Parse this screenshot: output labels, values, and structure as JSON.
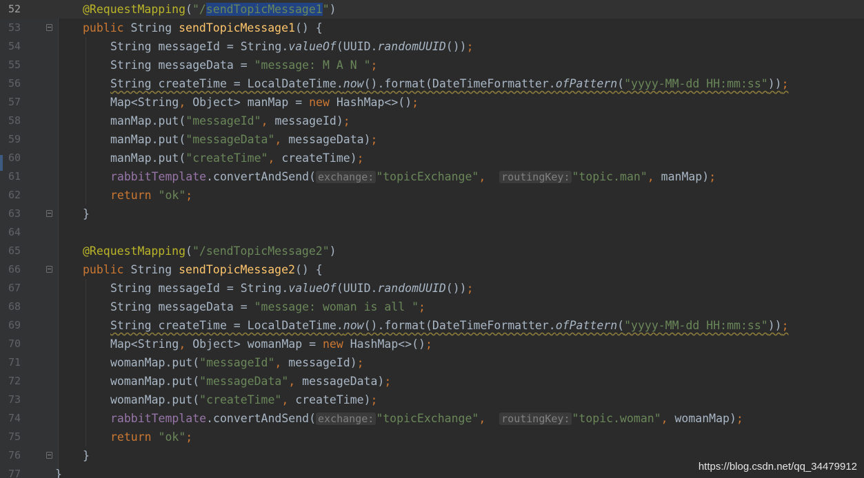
{
  "editor": {
    "current_line": 52,
    "watermark": "https://blog.csdn.net/qq_34479912",
    "closing_brace": "}",
    "colors": {
      "background": "#2b2b2b",
      "keyword": "#cc7832",
      "annotation": "#bbb529",
      "string": "#6a8759",
      "field": "#9876aa",
      "method_decl": "#ffc66d",
      "default_text": "#a9b7c6",
      "selection": "#214283"
    },
    "icons": [
      "fold-collapse-icon",
      "fold-end-icon"
    ]
  },
  "lines": [
    {
      "num": "52",
      "indent": 1,
      "fold": false,
      "tokens": [
        {
          "t": "@RequestMapping",
          "c": "ann"
        },
        {
          "t": "(",
          "c": ""
        },
        {
          "t": "\"/",
          "c": "str"
        },
        {
          "t": "sendTopicMessage1",
          "c": "str sel"
        },
        {
          "t": "\"",
          "c": "str"
        },
        {
          "t": ")",
          "c": ""
        }
      ]
    },
    {
      "num": "53",
      "indent": 1,
      "fold": true,
      "tokens": [
        {
          "t": "public ",
          "c": "kw"
        },
        {
          "t": "String ",
          "c": ""
        },
        {
          "t": "sendTopicMessage1",
          "c": "fn"
        },
        {
          "t": "() {",
          "c": ""
        }
      ]
    },
    {
      "num": "54",
      "indent": 2,
      "fold": false,
      "tokens": [
        {
          "t": "String messageId = String.",
          "c": ""
        },
        {
          "t": "valueOf",
          "c": "ital"
        },
        {
          "t": "(UUID.",
          "c": ""
        },
        {
          "t": "randomUUID",
          "c": "ital"
        },
        {
          "t": "())",
          "c": ""
        },
        {
          "t": ";",
          "c": "kw"
        }
      ]
    },
    {
      "num": "55",
      "indent": 2,
      "fold": false,
      "tokens": [
        {
          "t": "String messageData = ",
          "c": ""
        },
        {
          "t": "\"message: M A N \"",
          "c": "str"
        },
        {
          "t": ";",
          "c": "kw"
        }
      ]
    },
    {
      "num": "56",
      "indent": 2,
      "fold": false,
      "tokens": [
        {
          "t": "String createTime = LocalDateTime.",
          "c": "warn"
        },
        {
          "t": "now",
          "c": "ital warn"
        },
        {
          "t": "().format(DateTimeFormatter.",
          "c": "warn"
        },
        {
          "t": "ofPattern",
          "c": "ital warn"
        },
        {
          "t": "(",
          "c": "warn"
        },
        {
          "t": "\"yyyy-MM-dd HH:mm:ss\"",
          "c": "str warn"
        },
        {
          "t": "))",
          "c": "warn"
        },
        {
          "t": ";",
          "c": "kw warn"
        }
      ]
    },
    {
      "num": "57",
      "indent": 2,
      "fold": false,
      "tokens": [
        {
          "t": "Map<String",
          "c": ""
        },
        {
          "t": ", ",
          "c": "kw"
        },
        {
          "t": "Object> manMap = ",
          "c": ""
        },
        {
          "t": "new ",
          "c": "kw"
        },
        {
          "t": "HashMap<>()",
          "c": ""
        },
        {
          "t": ";",
          "c": "kw"
        }
      ]
    },
    {
      "num": "58",
      "indent": 2,
      "fold": false,
      "tokens": [
        {
          "t": "manMap.put(",
          "c": ""
        },
        {
          "t": "\"messageId\"",
          "c": "str"
        },
        {
          "t": ", ",
          "c": "kw"
        },
        {
          "t": "messageId)",
          "c": ""
        },
        {
          "t": ";",
          "c": "kw"
        }
      ]
    },
    {
      "num": "59",
      "indent": 2,
      "fold": false,
      "tokens": [
        {
          "t": "manMap.put(",
          "c": ""
        },
        {
          "t": "\"messageData\"",
          "c": "str"
        },
        {
          "t": ", ",
          "c": "kw"
        },
        {
          "t": "messageData)",
          "c": ""
        },
        {
          "t": ";",
          "c": "kw"
        }
      ]
    },
    {
      "num": "60",
      "indent": 2,
      "fold": false,
      "tokens": [
        {
          "t": "manMap.put(",
          "c": ""
        },
        {
          "t": "\"createTime\"",
          "c": "str"
        },
        {
          "t": ", ",
          "c": "kw"
        },
        {
          "t": "createTime)",
          "c": ""
        },
        {
          "t": ";",
          "c": "kw"
        }
      ]
    },
    {
      "num": "61",
      "indent": 2,
      "fold": false,
      "tokens": [
        {
          "t": "rabbitTemplate",
          "c": "fld"
        },
        {
          "t": ".convertAndSend(",
          "c": ""
        },
        {
          "t": "exchange:",
          "c": "hint"
        },
        {
          "t": "\"topicExchange\"",
          "c": "str"
        },
        {
          "t": ",  ",
          "c": "kw"
        },
        {
          "t": "routingKey:",
          "c": "hint"
        },
        {
          "t": "\"topic.man\"",
          "c": "str"
        },
        {
          "t": ", ",
          "c": "kw"
        },
        {
          "t": "manMap)",
          "c": ""
        },
        {
          "t": ";",
          "c": "kw"
        }
      ]
    },
    {
      "num": "62",
      "indent": 2,
      "fold": false,
      "tokens": [
        {
          "t": "return ",
          "c": "kw"
        },
        {
          "t": "\"ok\"",
          "c": "str"
        },
        {
          "t": ";",
          "c": "kw"
        }
      ]
    },
    {
      "num": "63",
      "indent": 1,
      "fold": true,
      "tokens": [
        {
          "t": "}",
          "c": ""
        }
      ]
    },
    {
      "num": "64",
      "indent": 0,
      "fold": false,
      "tokens": []
    },
    {
      "num": "65",
      "indent": 1,
      "fold": false,
      "tokens": [
        {
          "t": "@RequestMapping",
          "c": "ann"
        },
        {
          "t": "(",
          "c": ""
        },
        {
          "t": "\"/sendTopicMessage2\"",
          "c": "str"
        },
        {
          "t": ")",
          "c": ""
        }
      ]
    },
    {
      "num": "66",
      "indent": 1,
      "fold": true,
      "tokens": [
        {
          "t": "public ",
          "c": "kw"
        },
        {
          "t": "String ",
          "c": ""
        },
        {
          "t": "sendTopicMessage2",
          "c": "fn"
        },
        {
          "t": "() {",
          "c": ""
        }
      ]
    },
    {
      "num": "67",
      "indent": 2,
      "fold": false,
      "tokens": [
        {
          "t": "String messageId = String.",
          "c": ""
        },
        {
          "t": "valueOf",
          "c": "ital"
        },
        {
          "t": "(UUID.",
          "c": ""
        },
        {
          "t": "randomUUID",
          "c": "ital"
        },
        {
          "t": "())",
          "c": ""
        },
        {
          "t": ";",
          "c": "kw"
        }
      ]
    },
    {
      "num": "68",
      "indent": 2,
      "fold": false,
      "tokens": [
        {
          "t": "String messageData = ",
          "c": ""
        },
        {
          "t": "\"message: woman is all \"",
          "c": "str"
        },
        {
          "t": ";",
          "c": "kw"
        }
      ]
    },
    {
      "num": "69",
      "indent": 2,
      "fold": false,
      "tokens": [
        {
          "t": "String createTime = LocalDateTime.",
          "c": "warn"
        },
        {
          "t": "now",
          "c": "ital warn"
        },
        {
          "t": "().format(DateTimeFormatter.",
          "c": "warn"
        },
        {
          "t": "ofPattern",
          "c": "ital warn"
        },
        {
          "t": "(",
          "c": "warn"
        },
        {
          "t": "\"yyyy-MM-dd HH:mm:ss\"",
          "c": "str warn"
        },
        {
          "t": "))",
          "c": "warn"
        },
        {
          "t": ";",
          "c": "kw warn"
        }
      ]
    },
    {
      "num": "70",
      "indent": 2,
      "fold": false,
      "tokens": [
        {
          "t": "Map<String",
          "c": ""
        },
        {
          "t": ", ",
          "c": "kw"
        },
        {
          "t": "Object> womanMap = ",
          "c": ""
        },
        {
          "t": "new ",
          "c": "kw"
        },
        {
          "t": "HashMap<>()",
          "c": ""
        },
        {
          "t": ";",
          "c": "kw"
        }
      ]
    },
    {
      "num": "71",
      "indent": 2,
      "fold": false,
      "tokens": [
        {
          "t": "womanMap.put(",
          "c": ""
        },
        {
          "t": "\"messageId\"",
          "c": "str"
        },
        {
          "t": ", ",
          "c": "kw"
        },
        {
          "t": "messageId)",
          "c": ""
        },
        {
          "t": ";",
          "c": "kw"
        }
      ]
    },
    {
      "num": "72",
      "indent": 2,
      "fold": false,
      "tokens": [
        {
          "t": "womanMap.put(",
          "c": ""
        },
        {
          "t": "\"messageData\"",
          "c": "str"
        },
        {
          "t": ", ",
          "c": "kw"
        },
        {
          "t": "messageData)",
          "c": ""
        },
        {
          "t": ";",
          "c": "kw"
        }
      ]
    },
    {
      "num": "73",
      "indent": 2,
      "fold": false,
      "tokens": [
        {
          "t": "womanMap.put(",
          "c": ""
        },
        {
          "t": "\"createTime\"",
          "c": "str"
        },
        {
          "t": ", ",
          "c": "kw"
        },
        {
          "t": "createTime)",
          "c": ""
        },
        {
          "t": ";",
          "c": "kw"
        }
      ]
    },
    {
      "num": "74",
      "indent": 2,
      "fold": false,
      "tokens": [
        {
          "t": "rabbitTemplate",
          "c": "fld"
        },
        {
          "t": ".convertAndSend(",
          "c": ""
        },
        {
          "t": "exchange:",
          "c": "hint"
        },
        {
          "t": "\"topicExchange\"",
          "c": "str"
        },
        {
          "t": ",  ",
          "c": "kw"
        },
        {
          "t": "routingKey:",
          "c": "hint"
        },
        {
          "t": "\"topic.woman\"",
          "c": "str"
        },
        {
          "t": ", ",
          "c": "kw"
        },
        {
          "t": "womanMap)",
          "c": ""
        },
        {
          "t": ";",
          "c": "kw"
        }
      ]
    },
    {
      "num": "75",
      "indent": 2,
      "fold": false,
      "tokens": [
        {
          "t": "return ",
          "c": "kw"
        },
        {
          "t": "\"ok\"",
          "c": "str"
        },
        {
          "t": ";",
          "c": "kw"
        }
      ]
    },
    {
      "num": "76",
      "indent": 1,
      "fold": true,
      "tokens": [
        {
          "t": "}",
          "c": ""
        }
      ]
    },
    {
      "num": "77",
      "indent": 0,
      "fold": false,
      "tokens": []
    }
  ]
}
